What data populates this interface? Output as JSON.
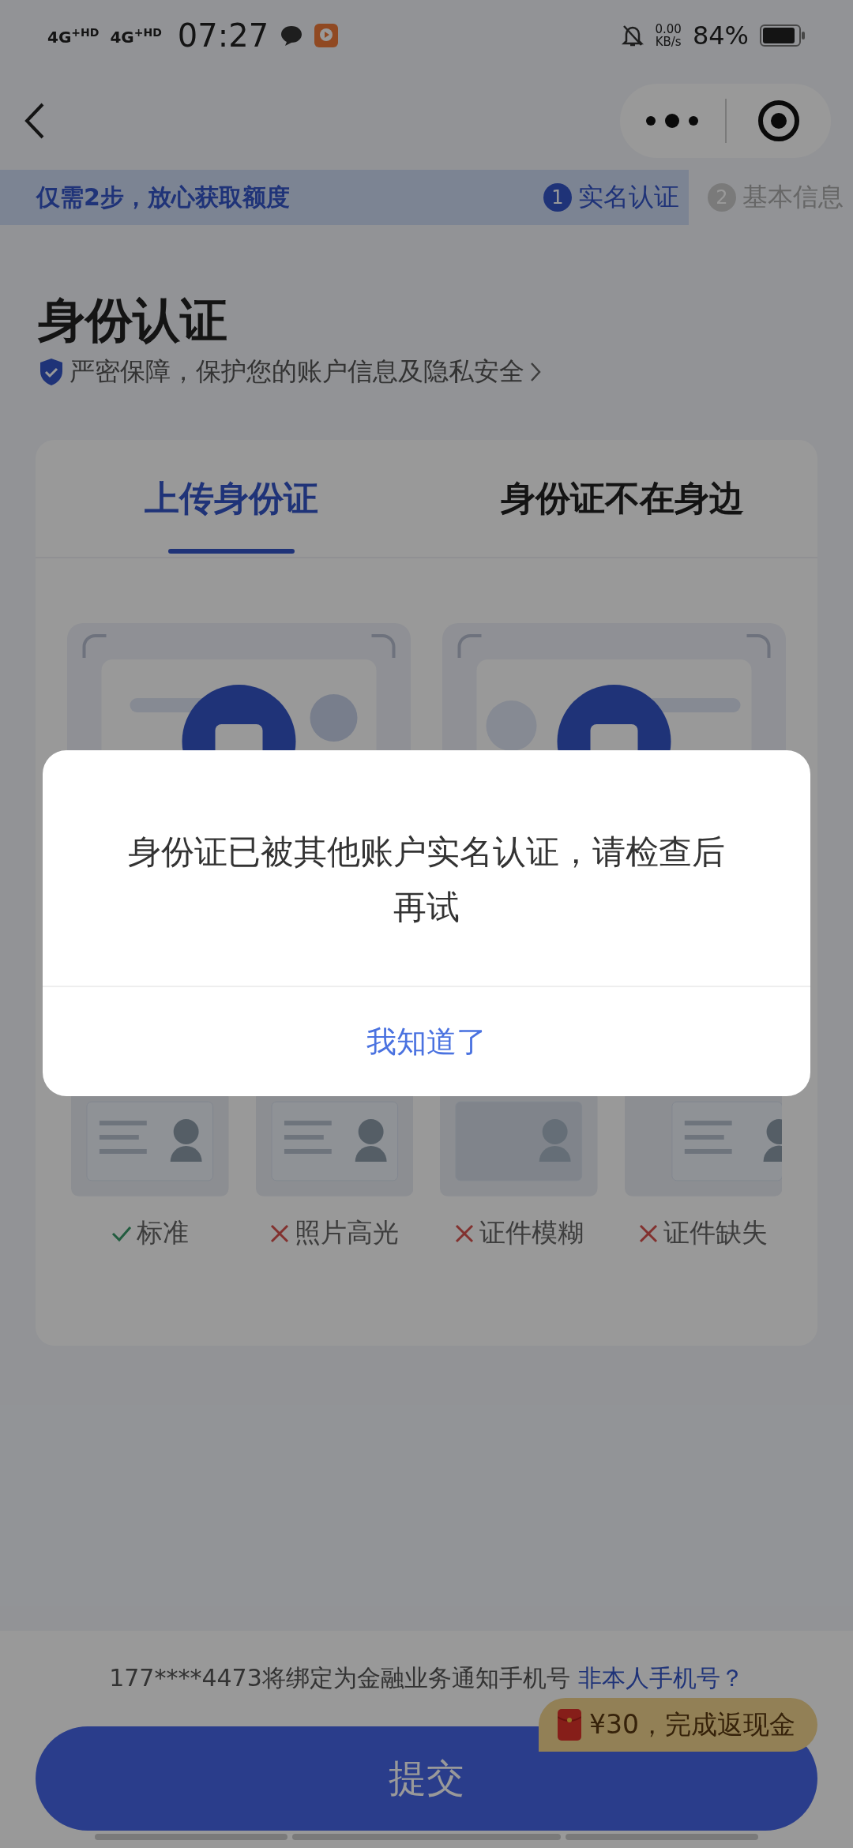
{
  "status_bar": {
    "network_1": "4G$^{+HD}$",
    "network_2": "4G$^{+HD}$",
    "time": "07:27",
    "speed_value": "0.00",
    "speed_unit": "KB/s",
    "battery": "84%"
  },
  "banner": {
    "slogan": "仅需2步，放心获取额度",
    "steps": [
      {
        "number": "1",
        "label": "实名认证",
        "selected": true
      },
      {
        "number": "2",
        "label": "基本信息",
        "selected": false
      }
    ]
  },
  "title": "身份认证",
  "notice": "严密保障，保护您的账户信息及隐私安全",
  "tabs": [
    {
      "label": "上传身份证",
      "selected": true
    },
    {
      "label": "身份证不在身边",
      "selected": false
    }
  ],
  "examples": [
    {
      "label": "标准",
      "valid": true
    },
    {
      "label": "照片高光",
      "valid": false
    },
    {
      "label": "证件模糊",
      "valid": false
    },
    {
      "label": "证件缺失",
      "valid": false
    }
  ],
  "phone_notice": {
    "text": "177****4473将绑定为金融业务通知手机号",
    "link": "非本人手机号？"
  },
  "submit": "提交",
  "promo": "¥30，完成返现金",
  "dialog": {
    "message": "身份证已被其他账户实名认证，请检查后再试",
    "button": "我知道了"
  }
}
